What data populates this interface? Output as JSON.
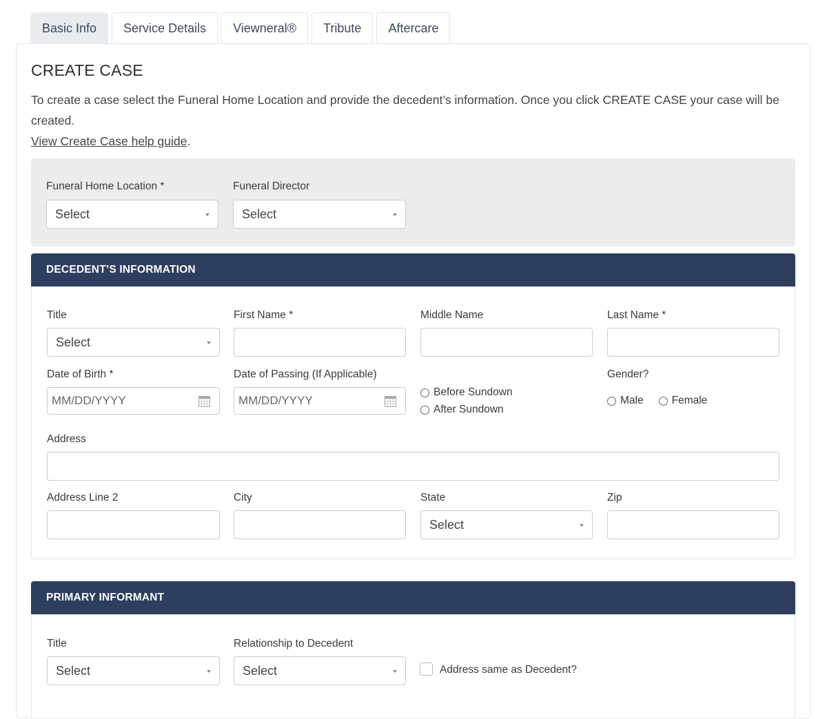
{
  "tabs": [
    "Basic Info",
    "Service Details",
    "Viewneral®",
    "Tribute",
    "Aftercare"
  ],
  "page_title": "CREATE CASE",
  "intro": {
    "text": "To create a case select the Funeral Home Location and provide the decedent’s information. Once you click CREATE CASE your case will be created.",
    "link": "View Create Case help guide",
    "tail": "."
  },
  "location": {
    "funeral_home_label": "Funeral Home Location *",
    "funeral_home_value": "Select",
    "director_label": "Funeral Director",
    "director_value": "Select"
  },
  "decedent": {
    "header": "DECEDENT’S INFORMATION",
    "title_label": "Title",
    "title_value": "Select",
    "first_name_label": "First Name *",
    "middle_name_label": "Middle Name",
    "last_name_label": "Last Name *",
    "dob_label": "Date of Birth *",
    "dob_placeholder": "MM/DD/YYYY",
    "dop_label": "Date of Passing (If Applicable)",
    "dop_placeholder": "MM/DD/YYYY",
    "before_sundown": "Before Sundown",
    "after_sundown": "After Sundown",
    "gender_label": "Gender?",
    "male": "Male",
    "female": "Female",
    "address_label": "Address",
    "address2_label": "Address Line 2",
    "city_label": "City",
    "state_label": "State",
    "state_value": "Select",
    "zip_label": "Zip"
  },
  "informant": {
    "header": "PRIMARY INFORMANT",
    "title_label": "Title",
    "title_value": "Select",
    "relationship_label": "Relationship to Decedent",
    "relationship_value": "Select",
    "same_address_label": "Address same as Decedent?"
  }
}
